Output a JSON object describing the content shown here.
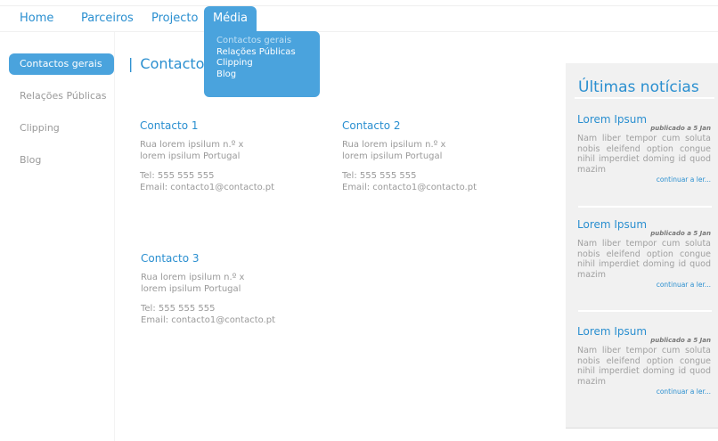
{
  "nav": {
    "items": [
      {
        "label": "Home"
      },
      {
        "label": "Parceiros"
      },
      {
        "label": "Projecto"
      },
      {
        "label": "Média"
      }
    ],
    "dropdown": [
      "Contactos gerais",
      "Relações Públicas",
      "Clipping",
      "Blog"
    ]
  },
  "sidebar": {
    "items": [
      {
        "label": "Contactos gerais"
      },
      {
        "label": "Relações Públicas"
      },
      {
        "label": "Clipping"
      },
      {
        "label": "Blog"
      }
    ]
  },
  "main": {
    "title_bar": "|",
    "title": "Contactos Gerais",
    "contacts": [
      {
        "name": "Contacto 1",
        "address1": "Rua lorem ipsilum n.º x",
        "address2": "lorem ipsilum Portugal",
        "tel": "Tel: 555 555 555",
        "email": "Email: contacto1@contacto.pt"
      },
      {
        "name": "Contacto 2",
        "address1": "Rua lorem ipsilum n.º x",
        "address2": "lorem ipsilum Portugal",
        "tel": "Tel: 555 555 555",
        "email": "Email: contacto1@contacto.pt"
      },
      {
        "name": "Contacto 3",
        "address1": "Rua lorem ipsilum n.º x",
        "address2": "lorem ipsilum Portugal",
        "tel": "Tel: 555 555 555",
        "email": "Email: contacto1@contacto.pt"
      }
    ]
  },
  "news": {
    "title": "Últimas notícias",
    "items": [
      {
        "title": "Lorem Ipsum",
        "date": "publicado a 5 Jan",
        "body": "Nam liber tempor cum soluta nobis eleifend option congue nihil imperdiet doming id quod mazim",
        "more": "continuar a ler..."
      },
      {
        "title": "Lorem Ipsum",
        "date": "publicado a 5 Jan",
        "body": "Nam liber tempor cum soluta nobis eleifend option congue nihil imperdiet doming id quod mazim",
        "more": "continuar a ler..."
      },
      {
        "title": "Lorem Ipsum",
        "date": "publicado a 5 Jan",
        "body": "Nam liber tempor cum soluta nobis eleifend option congue nihil imperdiet doming id quod mazim",
        "more": "continuar a ler..."
      }
    ]
  },
  "colors": {
    "accent": "#4aa3dd",
    "link": "#2a8fd0",
    "text": "#999999",
    "news_bg": "#f1f1f1"
  }
}
